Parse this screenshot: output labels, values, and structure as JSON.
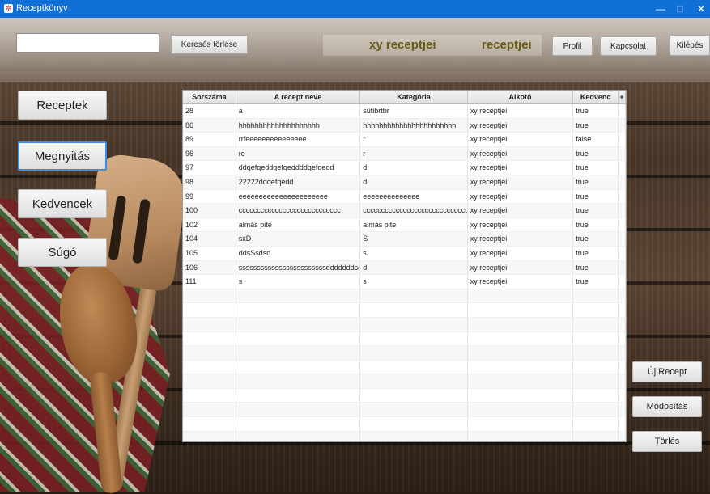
{
  "window": {
    "title": "Receptkönyv",
    "app_icon": "app-logo-icon",
    "controls": {
      "minimize": "—",
      "maximize": "□",
      "close": "✕"
    }
  },
  "toolbar": {
    "search_value": "",
    "clear_search_label": "Keresés törlése",
    "header_primary": "xy receptjei",
    "header_secondary": "receptjei",
    "profile_label": "Profil",
    "contact_label": "Kapcsolat",
    "exit_label": "Kilépés"
  },
  "sidebar": {
    "items": [
      {
        "label": "Receptek",
        "active": false
      },
      {
        "label": "Megnyitás",
        "active": true
      },
      {
        "label": "Kedvencek",
        "active": false
      },
      {
        "label": "Súgó",
        "active": false
      }
    ]
  },
  "table": {
    "columns": [
      "Sorszáma",
      "A recept neve",
      "Kategória",
      "Alkotó",
      "Kedvenc",
      "+"
    ],
    "rows": [
      [
        "28",
        "a",
        "sütibrtbr",
        "xy receptjei",
        "true"
      ],
      [
        "86",
        "hhhhhhhhhhhhhhhhhhhh",
        "hhhhhhhhhhhhhhhhhhhhhhh",
        "xy receptjei",
        "true"
      ],
      [
        "89",
        "rrfeeeeeeeeeeeeeee",
        "r",
        "xy receptjei",
        "false"
      ],
      [
        "96",
        "re",
        "r",
        "xy receptjei",
        "true"
      ],
      [
        "97",
        "ddqefqeddqefqeddddqefqedd",
        "d",
        "xy receptjei",
        "true"
      ],
      [
        "98",
        "22222ddqefqedd",
        "d",
        "xy receptjei",
        "true"
      ],
      [
        "99",
        "eeeeeeeeeeeeeeeeeeeeee",
        "eeeeeeeeeeeeee",
        "xy receptjei",
        "true"
      ],
      [
        "100",
        "cccccccccccccccccccccccccccc",
        "cccccccccccccccccccccccccccccccc",
        "xy receptjei",
        "true"
      ],
      [
        "102",
        "almás pite",
        "almás pite",
        "xy receptjei",
        "true"
      ],
      [
        "104",
        "sxD",
        "S",
        "xy receptjei",
        "true"
      ],
      [
        "105",
        "ddsSsdsd",
        "s",
        "xy receptjei",
        "true"
      ],
      [
        "106",
        "ssssssssssssssssssssssssdddddddsdsd",
        "d",
        "xy receptjei",
        "true"
      ],
      [
        "111",
        "s",
        "s",
        "xy receptjei",
        "true"
      ]
    ],
    "empty_rows": 11
  },
  "actions": {
    "new_recipe": "Új Recept",
    "modify": "Módosítás",
    "delete": "Törlés"
  }
}
